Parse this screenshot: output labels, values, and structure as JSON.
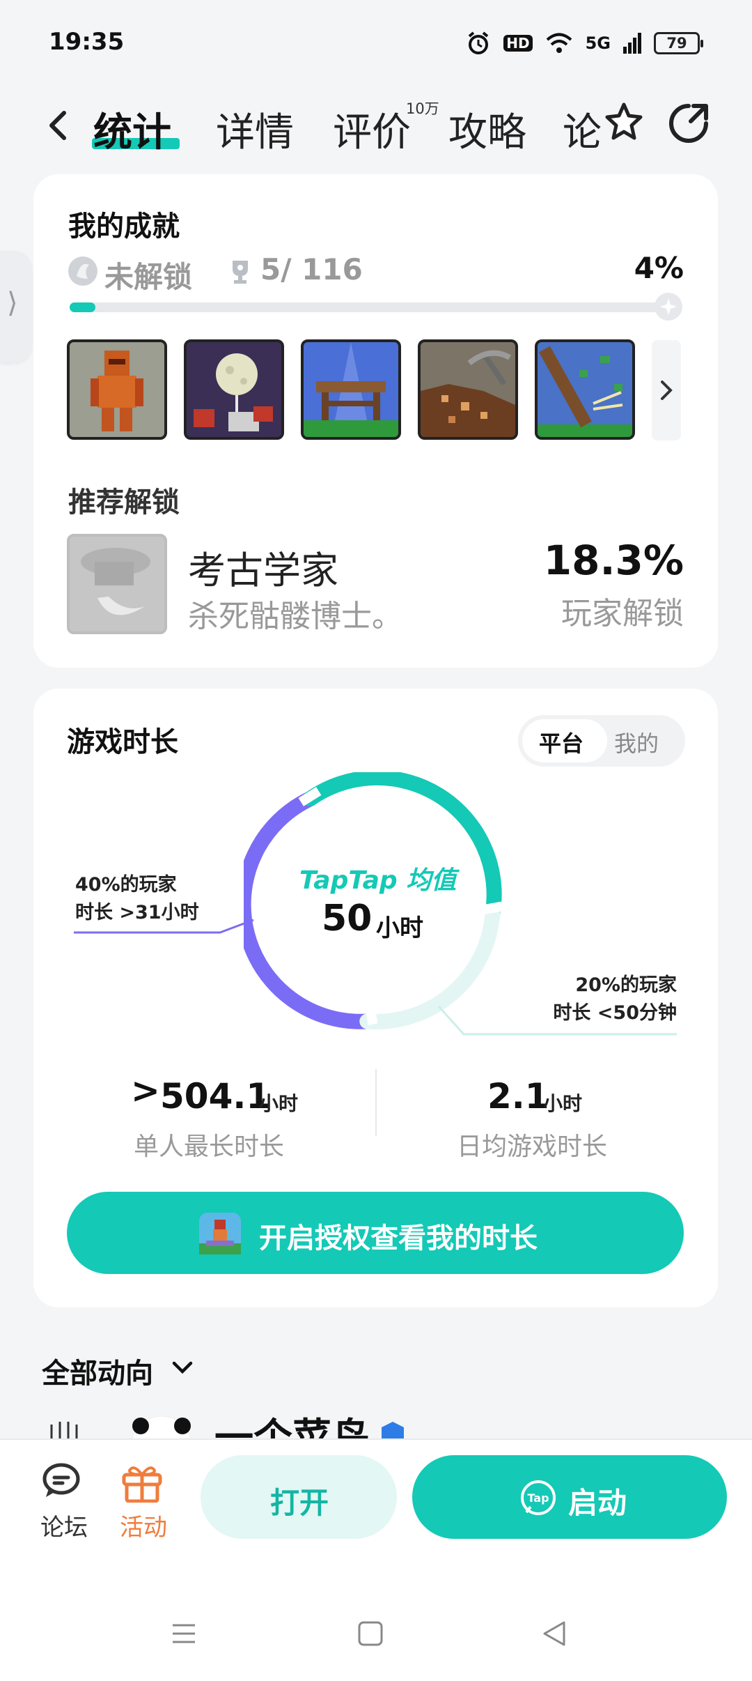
{
  "status_bar": {
    "time": "19:35",
    "hd": "HD",
    "network": "5G",
    "battery": "79"
  },
  "header": {
    "tabs": [
      "统计",
      "详情",
      "评价",
      "攻略",
      "论"
    ],
    "review_count": "10万"
  },
  "achievements": {
    "title": "我的成就",
    "locked_label": "未解锁",
    "progress_text": "5/ 116",
    "percent": "4%",
    "progress_fraction": 0.043,
    "recommend_title": "推荐解锁",
    "recommended": {
      "name": "考古学家",
      "desc": "杀死骷髅博士。",
      "percent": "18.3%",
      "percent_label": "玩家解锁"
    }
  },
  "playtime": {
    "title": "游戏时长",
    "toggle": [
      "平台",
      "我的"
    ],
    "ring_title": "TapTap 均值",
    "ring_value": "50",
    "ring_unit": "小时",
    "left_note_1": "40%的玩家",
    "left_note_2": "时长 >31小时",
    "right_note_1": "20%的玩家",
    "right_note_2": "时长 <50分钟",
    "max_prefix": ">",
    "max_value": "504.1",
    "max_unit": "小时",
    "max_label": "单人最长时长",
    "daily_value": "2.1",
    "daily_unit": "小时",
    "daily_label": "日均游戏时长",
    "cta": "开启授权查看我的时长"
  },
  "feed": {
    "title": "全部动向",
    "author": "一个菜鸟"
  },
  "bottom_bar": {
    "forum": "论坛",
    "activity": "活动",
    "open": "打开",
    "launch": "启动"
  },
  "colors": {
    "accent": "#14c9b6",
    "purple": "#7b6cf6",
    "orange": "#f07c3c"
  }
}
